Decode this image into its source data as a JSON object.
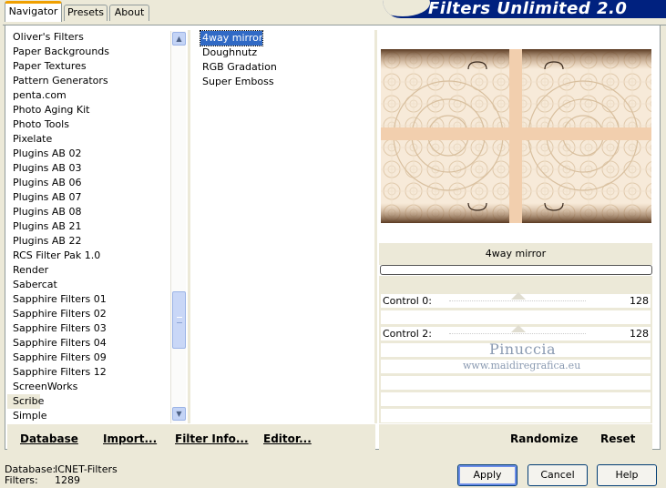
{
  "tabs": [
    {
      "label": "Navigator",
      "active": true
    },
    {
      "label": "Presets",
      "active": false
    },
    {
      "label": "About",
      "active": false
    }
  ],
  "banner": {
    "title": "Filters Unlimited 2.0"
  },
  "categories": [
    "Oliver's Filters",
    "Paper Backgrounds",
    "Paper Textures",
    "Pattern Generators",
    "penta.com",
    "Photo Aging Kit",
    "Photo Tools",
    "Pixelate",
    "Plugins AB 02",
    "Plugins AB 03",
    "Plugins AB 06",
    "Plugins AB 07",
    "Plugins AB 08",
    "Plugins AB 21",
    "Plugins AB 22",
    "RCS Filter Pak 1.0",
    "Render",
    "Sabercat",
    "Sapphire Filters 01",
    "Sapphire Filters 02",
    "Sapphire Filters 03",
    "Sapphire Filters 04",
    "Sapphire Filters 09",
    "Sapphire Filters 12",
    "ScreenWorks",
    "Scribe",
    "Simple"
  ],
  "selected_category": "Scribe",
  "filters": [
    "4way mirror",
    "Doughnutz",
    "RGB Gradation",
    "Super Emboss"
  ],
  "selected_filter": "4way mirror",
  "preview": {
    "filter_name": "4way mirror"
  },
  "controls": [
    {
      "label": "Control 0:",
      "value": "128"
    },
    {
      "label": "Control 2:",
      "value": "128"
    }
  ],
  "watermark": {
    "line1": "Pinuccia",
    "line2": "www.maidiregrafica.eu"
  },
  "left_buttons": {
    "database": "Database",
    "import": "Import...",
    "filter_info": "Filter Info...",
    "editor": "Editor..."
  },
  "right_buttons": {
    "randomize": "Randomize",
    "reset": "Reset"
  },
  "status": {
    "database_label": "Database:",
    "database_value": "ICNET-Filters",
    "filters_label": "Filters:",
    "filters_value": "1289"
  },
  "dialog_buttons": {
    "apply": "Apply",
    "cancel": "Cancel",
    "help": "Help"
  }
}
